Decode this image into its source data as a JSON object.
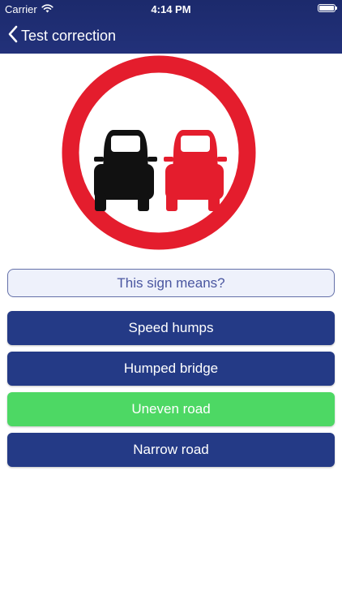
{
  "status_bar": {
    "carrier": "Carrier",
    "time": "4:14 PM",
    "wifi_icon": "wifi-icon",
    "battery_icon": "battery-icon"
  },
  "nav": {
    "back_icon": "chevron-left-icon",
    "title": "Test correction"
  },
  "sign": {
    "type": "no-overtaking-sign",
    "ring_color": "#e41d2d",
    "left_car_color": "#111111",
    "right_car_color": "#e41d2d"
  },
  "question": {
    "text": "This sign means?"
  },
  "answers": [
    {
      "label": "Speed humps",
      "color": "#243a86",
      "correct": false
    },
    {
      "label": "Humped bridge",
      "color": "#243a86",
      "correct": false
    },
    {
      "label": "Uneven road",
      "color": "#4dd864",
      "correct": true
    },
    {
      "label": "Narrow road",
      "color": "#243a86",
      "correct": false
    }
  ],
  "colors": {
    "nav_background": "#1f2e73",
    "answer_default": "#243a86",
    "answer_correct": "#4dd864",
    "question_border": "#6470a8",
    "question_text": "#4a56a0",
    "question_background": "#eef1fb"
  }
}
